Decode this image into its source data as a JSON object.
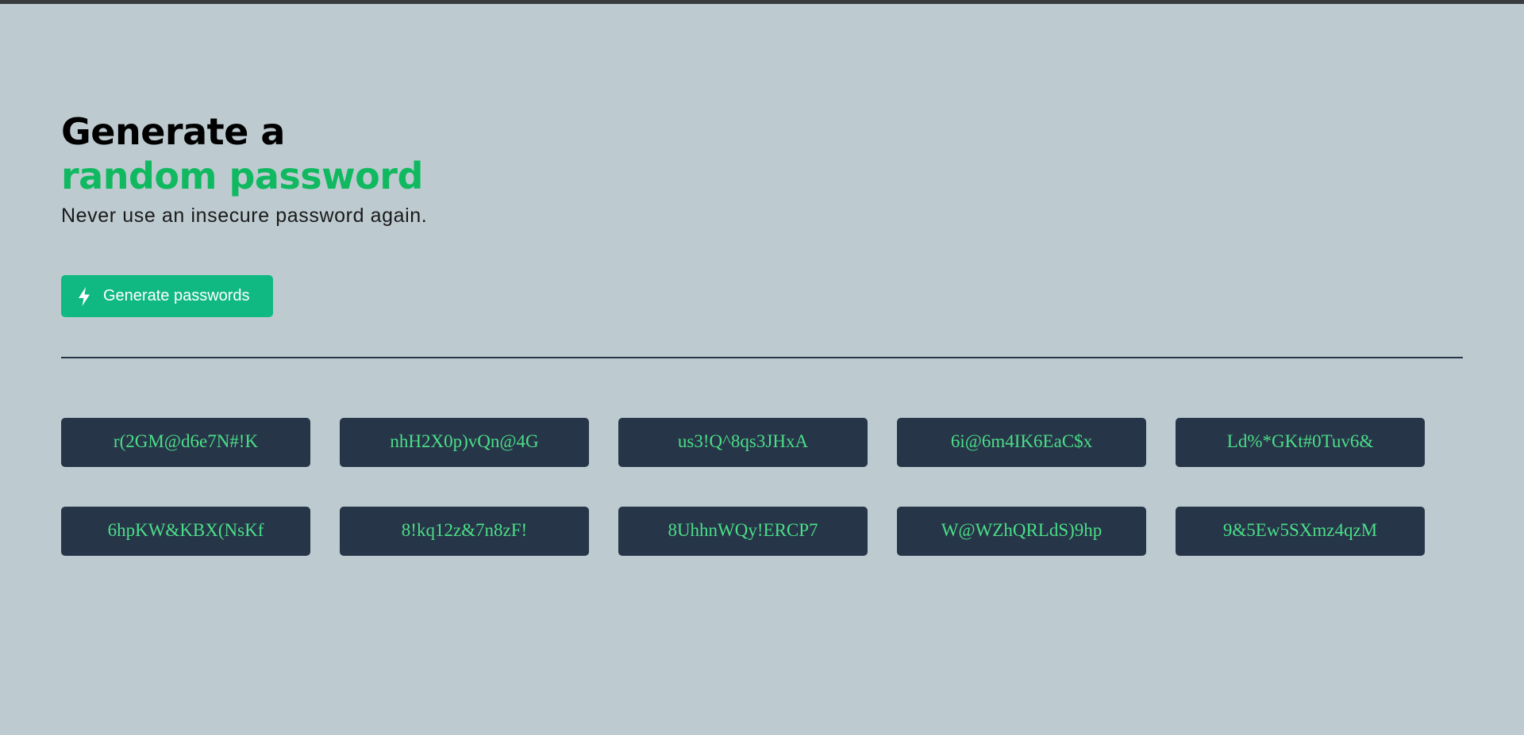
{
  "hero": {
    "title_line1": "Generate a",
    "title_line2": "random password",
    "subtitle": "Never use an insecure password again."
  },
  "generate_button": {
    "label": "Generate passwords",
    "icon": "lightning-bolt-icon"
  },
  "passwords": [
    "r(2GM@d6e7N#!K",
    "nhH2X0p)vQn@4G",
    "us3!Q^8qs3JHxA",
    "6i@6m4IK6EaC$x",
    "Ld%*GKt#0Tuv6&",
    "6hpKW&KBX(NsKf",
    "8!kq12z&7n8zF!",
    "8UhhnWQy!ERCP7",
    "W@WZhQRLdS)9hp",
    "9&5Ew5SXmz4qzM"
  ],
  "colors": {
    "background": "#bdcbd0",
    "accent": "#10b981",
    "title_accent": "#10b960",
    "card_bg": "#273549",
    "password_text": "#4adf86"
  }
}
